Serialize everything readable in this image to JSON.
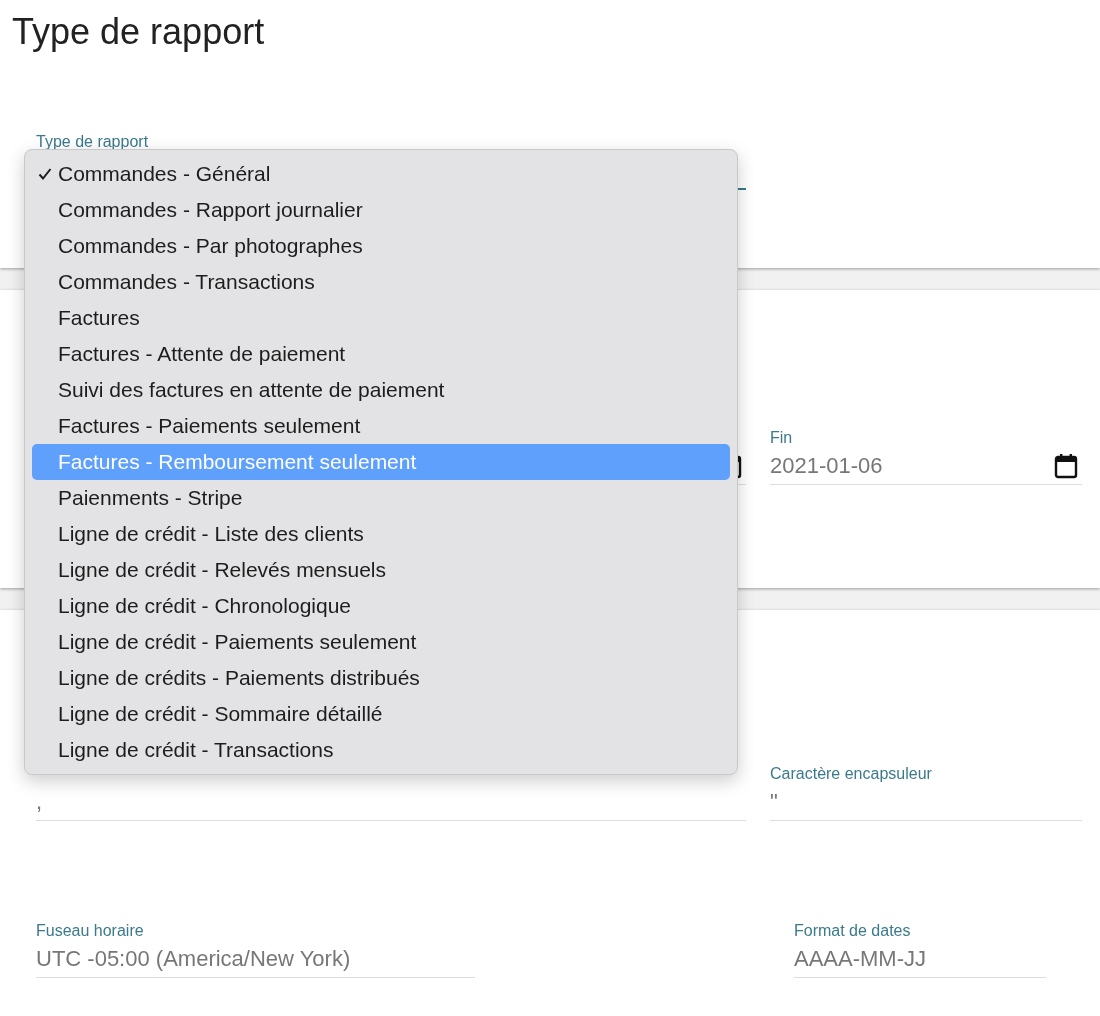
{
  "page": {
    "title": "Type de rapport"
  },
  "report_field": {
    "label": "Type de rapport"
  },
  "dropdown": {
    "options": [
      {
        "label": "Commandes - Général",
        "checked": true,
        "selected": false
      },
      {
        "label": "Commandes - Rapport journalier",
        "checked": false,
        "selected": false
      },
      {
        "label": "Commandes - Par photographes",
        "checked": false,
        "selected": false
      },
      {
        "label": "Commandes - Transactions",
        "checked": false,
        "selected": false
      },
      {
        "label": "Factures",
        "checked": false,
        "selected": false
      },
      {
        "label": "Factures - Attente de paiement",
        "checked": false,
        "selected": false
      },
      {
        "label": "Suivi des factures en attente de paiement",
        "checked": false,
        "selected": false
      },
      {
        "label": "Factures - Paiements seulement",
        "checked": false,
        "selected": false
      },
      {
        "label": "Factures - Remboursement seulement",
        "checked": false,
        "selected": true
      },
      {
        "label": "Paienments - Stripe",
        "checked": false,
        "selected": false
      },
      {
        "label": "Ligne de crédit - Liste des clients",
        "checked": false,
        "selected": false
      },
      {
        "label": "Ligne de crédit - Relevés mensuels",
        "checked": false,
        "selected": false
      },
      {
        "label": "Ligne de crédit - Chronologique",
        "checked": false,
        "selected": false
      },
      {
        "label": "Ligne de crédit - Paiements seulement",
        "checked": false,
        "selected": false
      },
      {
        "label": "Ligne de crédits - Paiements distribués",
        "checked": false,
        "selected": false
      },
      {
        "label": "Ligne de crédit - Sommaire détaillé",
        "checked": false,
        "selected": false
      },
      {
        "label": "Ligne de crédit - Transactions",
        "checked": false,
        "selected": false
      }
    ]
  },
  "period_section": {
    "end": {
      "label": "Fin",
      "value": "2021-01-06"
    }
  },
  "format_section": {
    "delimiter": {
      "value": ","
    },
    "enclosure": {
      "label": "Caractère encapsuleur",
      "value": "\""
    },
    "timezone": {
      "label": "Fuseau horaire",
      "value": "UTC -05:00 (America/New York)"
    },
    "date_format": {
      "label": "Format de dates",
      "value": "AAAA-MM-JJ"
    }
  }
}
